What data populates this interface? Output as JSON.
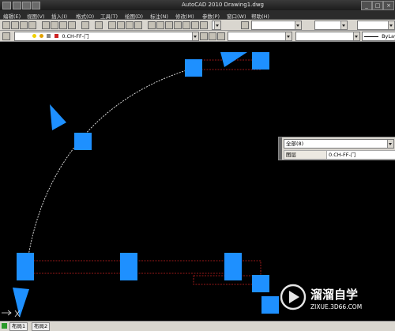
{
  "window": {
    "title": "AutoCAD 2010    Drawing1.dwg",
    "controls": [
      "_",
      "□",
      "×"
    ]
  },
  "menu": {
    "items": [
      "编辑(E)",
      "视图(V)",
      "插入(I)",
      "格式(O)",
      "工具(T)",
      "绘图(D)",
      "标注(N)",
      "修改(M)",
      "参数(P)",
      "窗口(W)",
      "帮助(H)"
    ]
  },
  "toolbar": {
    "layer_combo_value": "0.CH-FF-门",
    "linetype_combo_value": "ByLay"
  },
  "properties_panel": {
    "selection_value": "全部(8)",
    "row_label": "图层",
    "row_value": "0.CH-FF-门"
  },
  "statusbar": {
    "tabs": [
      "布局1",
      "布局2"
    ]
  },
  "watermark": {
    "brand": "溜溜自学",
    "url": "ZIXUE.3D66.COM"
  },
  "colors": {
    "grip": "#1e90ff",
    "door_line": "#cc2222",
    "background": "#000000"
  }
}
